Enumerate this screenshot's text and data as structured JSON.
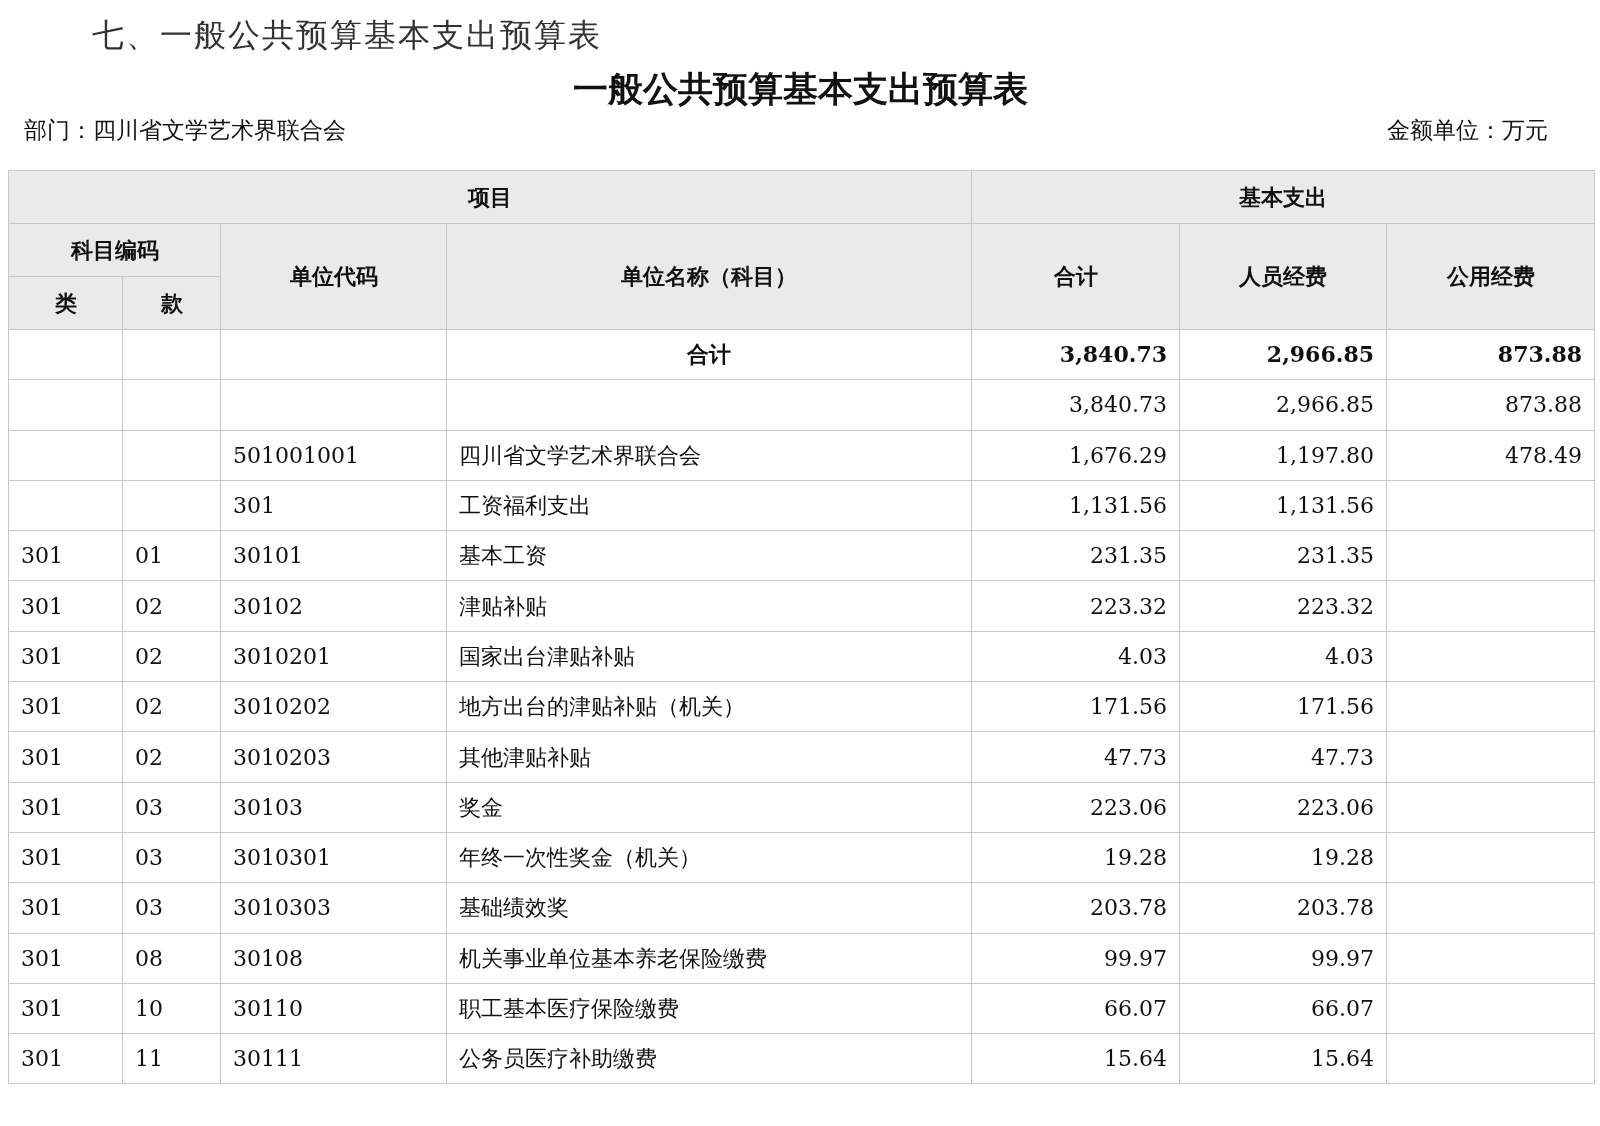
{
  "section_heading": "七、一般公共预算基本支出预算表",
  "title": "一般公共预算基本支出预算表",
  "department": "部门：四川省文学艺术界联合会",
  "unit": "金额单位：万元",
  "table": {
    "header": {
      "project": "项目",
      "basic": "基本支出",
      "subject_code": "科目编码",
      "class": "类",
      "item": "款",
      "unit_code": "单位代码",
      "unit_name": "单位名称（科目）",
      "total": "合计",
      "personnel": "人员经费",
      "public": "公用经费"
    },
    "rows": [
      {
        "kind": "total",
        "name": "合计",
        "total": "3,840.73",
        "personnel": "2,966.85",
        "public": "873.88"
      },
      {
        "kind": "normal",
        "total": "3,840.73",
        "personnel": "2,966.85",
        "public": "873.88"
      },
      {
        "kind": "normal",
        "code": "501001001",
        "name": "四川省文学艺术界联合会",
        "total": "1,676.29",
        "personnel": "1,197.80",
        "public": "478.49"
      },
      {
        "kind": "normal",
        "code": "301",
        "name": "工资福利支出",
        "total": "1,131.56",
        "personnel": "1,131.56"
      },
      {
        "kind": "normal",
        "lei": "301",
        "kuan": "01",
        "code": "30101",
        "name": "基本工资",
        "total": "231.35",
        "personnel": "231.35"
      },
      {
        "kind": "normal",
        "lei": "301",
        "kuan": "02",
        "code": "30102",
        "name": "津贴补贴",
        "total": "223.32",
        "personnel": "223.32"
      },
      {
        "kind": "normal",
        "lei": "301",
        "kuan": "02",
        "code": "3010201",
        "name": "国家出台津贴补贴",
        "total": "4.03",
        "personnel": "4.03"
      },
      {
        "kind": "normal",
        "lei": "301",
        "kuan": "02",
        "code": "3010202",
        "name": "地方出台的津贴补贴（机关）",
        "total": "171.56",
        "personnel": "171.56"
      },
      {
        "kind": "normal",
        "lei": "301",
        "kuan": "02",
        "code": "3010203",
        "name": "其他津贴补贴",
        "total": "47.73",
        "personnel": "47.73"
      },
      {
        "kind": "normal",
        "lei": "301",
        "kuan": "03",
        "code": "30103",
        "name": "奖金",
        "total": "223.06",
        "personnel": "223.06"
      },
      {
        "kind": "normal",
        "lei": "301",
        "kuan": "03",
        "code": "3010301",
        "name": "年终一次性奖金（机关）",
        "total": "19.28",
        "personnel": "19.28"
      },
      {
        "kind": "normal",
        "lei": "301",
        "kuan": "03",
        "code": "3010303",
        "name": "基础绩效奖",
        "total": "203.78",
        "personnel": "203.78"
      },
      {
        "kind": "normal",
        "lei": "301",
        "kuan": "08",
        "code": "30108",
        "name": "机关事业单位基本养老保险缴费",
        "total": "99.97",
        "personnel": "99.97"
      },
      {
        "kind": "normal",
        "lei": "301",
        "kuan": "10",
        "code": "30110",
        "name": "职工基本医疗保险缴费",
        "total": "66.07",
        "personnel": "66.07"
      },
      {
        "kind": "normal",
        "lei": "301",
        "kuan": "11",
        "code": "30111",
        "name": "公务员医疗补助缴费",
        "total": "15.64",
        "personnel": "15.64"
      }
    ]
  }
}
